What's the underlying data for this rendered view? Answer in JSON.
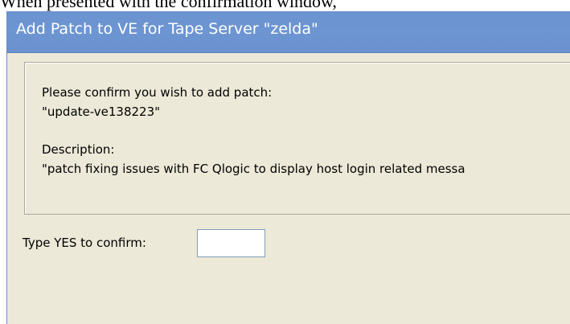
{
  "background_text": "When presented with the confirmation window,",
  "dialog": {
    "title": "Add Patch to VE for Tape Server \"zelda\"",
    "confirm_line": "Please confirm you wish to add patch:",
    "patch_name": "\"update-ve138223\"",
    "description_label": "Description:",
    "description_value": "\"patch fixing issues with FC Qlogic to display host login related messa",
    "confirm_prompt": "Type YES to confirm:",
    "confirm_input_value": ""
  }
}
